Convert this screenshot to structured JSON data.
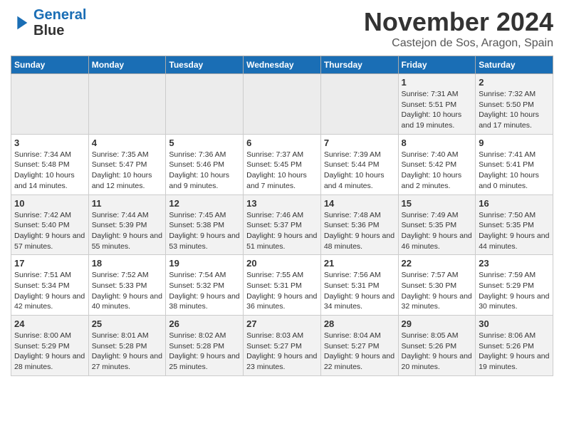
{
  "logo": {
    "line1": "General",
    "line2": "Blue"
  },
  "title": "November 2024",
  "subtitle": "Castejon de Sos, Aragon, Spain",
  "headers": [
    "Sunday",
    "Monday",
    "Tuesday",
    "Wednesday",
    "Thursday",
    "Friday",
    "Saturday"
  ],
  "weeks": [
    [
      {
        "day": "",
        "info": ""
      },
      {
        "day": "",
        "info": ""
      },
      {
        "day": "",
        "info": ""
      },
      {
        "day": "",
        "info": ""
      },
      {
        "day": "",
        "info": ""
      },
      {
        "day": "1",
        "info": "Sunrise: 7:31 AM\nSunset: 5:51 PM\nDaylight: 10 hours and 19 minutes."
      },
      {
        "day": "2",
        "info": "Sunrise: 7:32 AM\nSunset: 5:50 PM\nDaylight: 10 hours and 17 minutes."
      }
    ],
    [
      {
        "day": "3",
        "info": "Sunrise: 7:34 AM\nSunset: 5:48 PM\nDaylight: 10 hours and 14 minutes."
      },
      {
        "day": "4",
        "info": "Sunrise: 7:35 AM\nSunset: 5:47 PM\nDaylight: 10 hours and 12 minutes."
      },
      {
        "day": "5",
        "info": "Sunrise: 7:36 AM\nSunset: 5:46 PM\nDaylight: 10 hours and 9 minutes."
      },
      {
        "day": "6",
        "info": "Sunrise: 7:37 AM\nSunset: 5:45 PM\nDaylight: 10 hours and 7 minutes."
      },
      {
        "day": "7",
        "info": "Sunrise: 7:39 AM\nSunset: 5:44 PM\nDaylight: 10 hours and 4 minutes."
      },
      {
        "day": "8",
        "info": "Sunrise: 7:40 AM\nSunset: 5:42 PM\nDaylight: 10 hours and 2 minutes."
      },
      {
        "day": "9",
        "info": "Sunrise: 7:41 AM\nSunset: 5:41 PM\nDaylight: 10 hours and 0 minutes."
      }
    ],
    [
      {
        "day": "10",
        "info": "Sunrise: 7:42 AM\nSunset: 5:40 PM\nDaylight: 9 hours and 57 minutes."
      },
      {
        "day": "11",
        "info": "Sunrise: 7:44 AM\nSunset: 5:39 PM\nDaylight: 9 hours and 55 minutes."
      },
      {
        "day": "12",
        "info": "Sunrise: 7:45 AM\nSunset: 5:38 PM\nDaylight: 9 hours and 53 minutes."
      },
      {
        "day": "13",
        "info": "Sunrise: 7:46 AM\nSunset: 5:37 PM\nDaylight: 9 hours and 51 minutes."
      },
      {
        "day": "14",
        "info": "Sunrise: 7:48 AM\nSunset: 5:36 PM\nDaylight: 9 hours and 48 minutes."
      },
      {
        "day": "15",
        "info": "Sunrise: 7:49 AM\nSunset: 5:35 PM\nDaylight: 9 hours and 46 minutes."
      },
      {
        "day": "16",
        "info": "Sunrise: 7:50 AM\nSunset: 5:35 PM\nDaylight: 9 hours and 44 minutes."
      }
    ],
    [
      {
        "day": "17",
        "info": "Sunrise: 7:51 AM\nSunset: 5:34 PM\nDaylight: 9 hours and 42 minutes."
      },
      {
        "day": "18",
        "info": "Sunrise: 7:52 AM\nSunset: 5:33 PM\nDaylight: 9 hours and 40 minutes."
      },
      {
        "day": "19",
        "info": "Sunrise: 7:54 AM\nSunset: 5:32 PM\nDaylight: 9 hours and 38 minutes."
      },
      {
        "day": "20",
        "info": "Sunrise: 7:55 AM\nSunset: 5:31 PM\nDaylight: 9 hours and 36 minutes."
      },
      {
        "day": "21",
        "info": "Sunrise: 7:56 AM\nSunset: 5:31 PM\nDaylight: 9 hours and 34 minutes."
      },
      {
        "day": "22",
        "info": "Sunrise: 7:57 AM\nSunset: 5:30 PM\nDaylight: 9 hours and 32 minutes."
      },
      {
        "day": "23",
        "info": "Sunrise: 7:59 AM\nSunset: 5:29 PM\nDaylight: 9 hours and 30 minutes."
      }
    ],
    [
      {
        "day": "24",
        "info": "Sunrise: 8:00 AM\nSunset: 5:29 PM\nDaylight: 9 hours and 28 minutes."
      },
      {
        "day": "25",
        "info": "Sunrise: 8:01 AM\nSunset: 5:28 PM\nDaylight: 9 hours and 27 minutes."
      },
      {
        "day": "26",
        "info": "Sunrise: 8:02 AM\nSunset: 5:28 PM\nDaylight: 9 hours and 25 minutes."
      },
      {
        "day": "27",
        "info": "Sunrise: 8:03 AM\nSunset: 5:27 PM\nDaylight: 9 hours and 23 minutes."
      },
      {
        "day": "28",
        "info": "Sunrise: 8:04 AM\nSunset: 5:27 PM\nDaylight: 9 hours and 22 minutes."
      },
      {
        "day": "29",
        "info": "Sunrise: 8:05 AM\nSunset: 5:26 PM\nDaylight: 9 hours and 20 minutes."
      },
      {
        "day": "30",
        "info": "Sunrise: 8:06 AM\nSunset: 5:26 PM\nDaylight: 9 hours and 19 minutes."
      }
    ]
  ]
}
